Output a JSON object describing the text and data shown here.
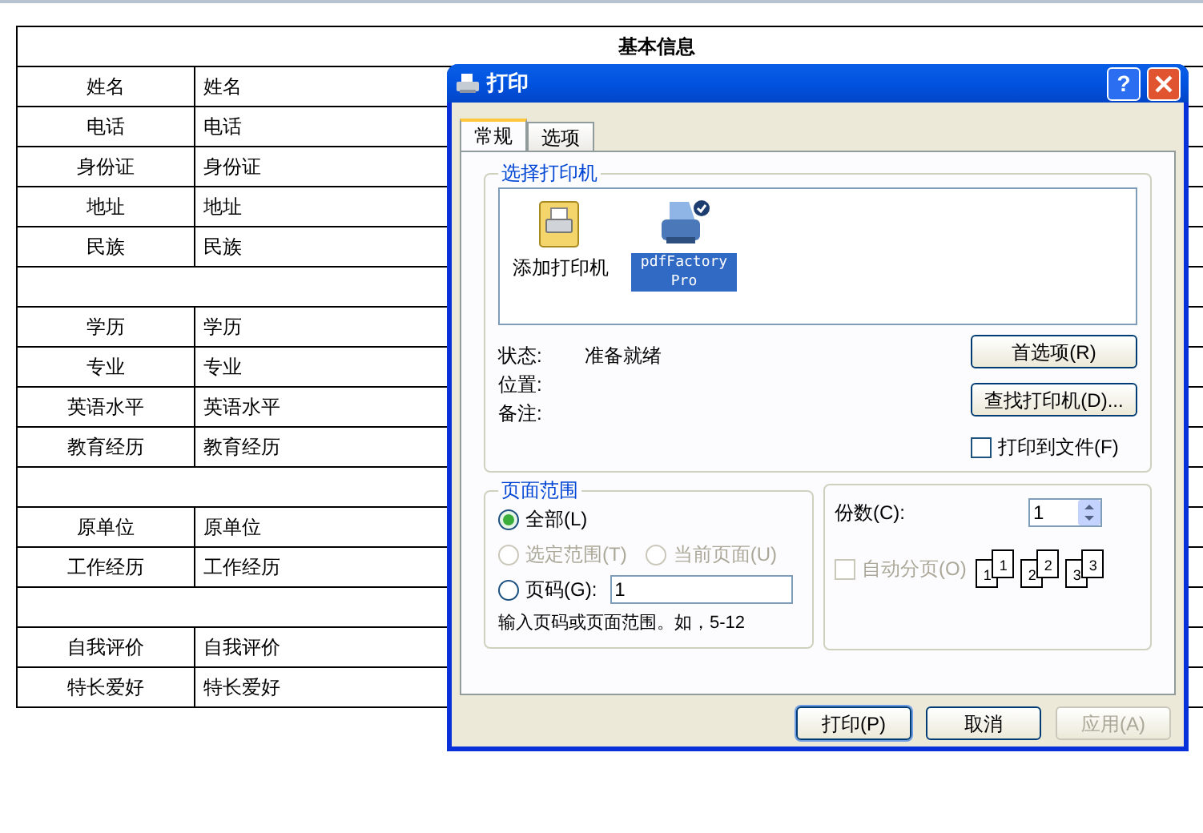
{
  "table": {
    "title": "基本信息",
    "rows": [
      {
        "kind": "field",
        "label": "姓名",
        "value": "姓名"
      },
      {
        "kind": "field",
        "label": "电话",
        "value": "电话"
      },
      {
        "kind": "field",
        "label": "身份证",
        "value": "身份证"
      },
      {
        "kind": "field",
        "label": "地址",
        "value": "地址"
      },
      {
        "kind": "field",
        "label": "民族",
        "value": "民族"
      },
      {
        "kind": "blank"
      },
      {
        "kind": "field",
        "label": "学历",
        "value": "学历"
      },
      {
        "kind": "field",
        "label": "专业",
        "value": "专业"
      },
      {
        "kind": "field",
        "label": "英语水平",
        "value": "英语水平"
      },
      {
        "kind": "field",
        "label": "教育经历",
        "value": "教育经历"
      },
      {
        "kind": "blank"
      },
      {
        "kind": "field",
        "label": "原单位",
        "value": "原单位"
      },
      {
        "kind": "field",
        "label": "工作经历",
        "value": "工作经历"
      },
      {
        "kind": "blank"
      },
      {
        "kind": "field",
        "label": "自我评价",
        "value": "自我评价"
      },
      {
        "kind": "field",
        "label": "特长爱好",
        "value": "特长爱好"
      }
    ]
  },
  "dialog": {
    "title": "打印",
    "help": "?",
    "tabs": [
      {
        "label": "常规",
        "selected": true
      },
      {
        "label": "选项",
        "selected": false
      }
    ],
    "printer_group": {
      "title": "选择打印机",
      "printers": [
        {
          "kind": "add",
          "name": "添加打印机",
          "selected": false
        },
        {
          "kind": "printer",
          "name": "pdfFactory Pro",
          "selected": true
        }
      ],
      "info": [
        {
          "label": "状态:",
          "value": "准备就绪"
        },
        {
          "label": "位置:"
        },
        {
          "label": "备注:"
        }
      ],
      "preferences_button": "首选项(R)",
      "find_button": "查找打印机(D)...",
      "print_to_file": {
        "label": "打印到文件(F)",
        "checked": false
      }
    },
    "page_range": {
      "title": "页面范围",
      "options": [
        {
          "label": "全部(L)",
          "selected": true,
          "disabled": false
        },
        {
          "label": "选定范围(T)",
          "selected": false,
          "disabled": true
        },
        {
          "label": "当前页面(U)",
          "selected": false,
          "disabled": true
        },
        {
          "label": "页码(G):",
          "selected": false,
          "disabled": false
        }
      ],
      "pages_value": "1",
      "hint": "输入页码或页面范围。如，5-12"
    },
    "copies": {
      "label": "份数(C):",
      "value": "1",
      "collate": {
        "label": "自动分页(O)",
        "checked": false,
        "disabled": true
      },
      "sheets": [
        {
          "back": "1",
          "front": "1"
        },
        {
          "back": "2",
          "front": "2"
        },
        {
          "back": "3",
          "front": "3"
        }
      ]
    },
    "buttons": [
      {
        "label": "打印(P)",
        "disabled": false,
        "default": true
      },
      {
        "label": "取消",
        "disabled": false,
        "default": false
      },
      {
        "label": "应用(A)",
        "disabled": true,
        "default": false
      }
    ]
  }
}
